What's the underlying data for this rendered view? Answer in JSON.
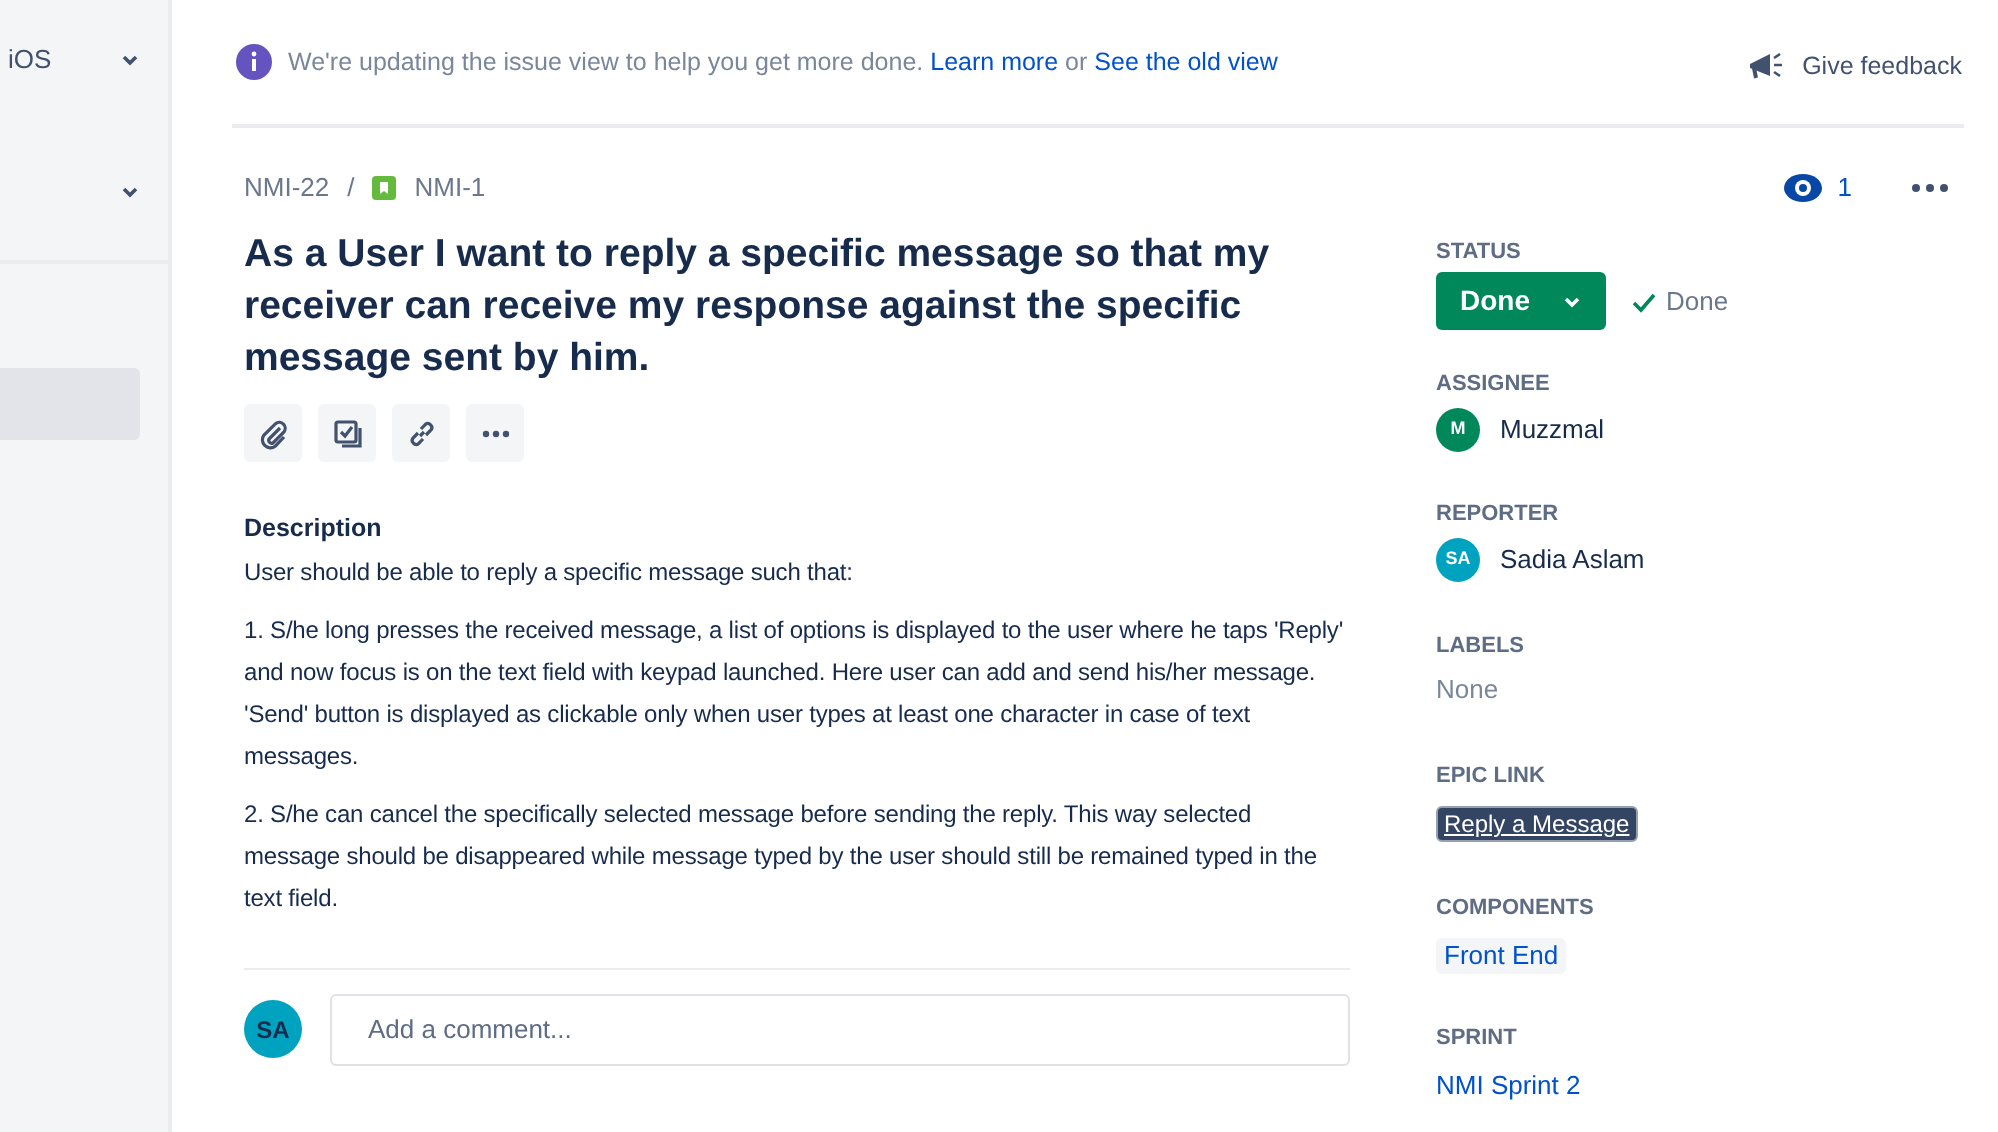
{
  "sidebar": {
    "items": [
      {
        "label": "iOS",
        "selected": false
      },
      {
        "selected": false
      },
      {
        "selected": true
      }
    ]
  },
  "banner": {
    "text": "We're updating the issue view to help you get more done.",
    "link1": "Learn more",
    "separator": "or",
    "link2": "See the old view",
    "feedback": "Give feedback"
  },
  "breadcrumb": {
    "parent": "NMI-22",
    "separator": "/",
    "issue": "NMI-1"
  },
  "watchers": "1",
  "title": "As a User I want to reply a specific message so that my receiver can receive my response against the specific message sent by him.",
  "description": {
    "heading": "Description",
    "paragraphs": [
      "User should be able to reply a specific message such that:",
      "1. S/he long presses the received message, a list of options is displayed to the user where he taps 'Reply' and now focus is on the text field with keypad launched. Here user can add and send his/her message. 'Send' button is displayed as clickable only when user types at least one character in case of text messages.",
      "2. S/he can cancel the specifically selected message before sending the reply. This way selected message should be disappeared while message typed by the user should still be remained typed in the text field."
    ]
  },
  "comment": {
    "avatar": "SA",
    "placeholder": "Add a comment..."
  },
  "fields": [
    {
      "kind": "status",
      "label": "STATUS",
      "value": "Done",
      "resolution": "Done"
    },
    {
      "kind": "user",
      "label": "ASSIGNEE",
      "initials": "M",
      "value": "Muzzmal",
      "color": "#00875a"
    },
    {
      "kind": "user",
      "label": "REPORTER",
      "initials": "SA",
      "value": "Sadia Aslam",
      "color": "#00a3bf"
    },
    {
      "kind": "empty",
      "label": "LABELS",
      "value": "None"
    },
    {
      "kind": "epic",
      "label": "EPIC LINK",
      "value": "Reply a Message"
    },
    {
      "kind": "tag",
      "label": "COMPONENTS",
      "value": "Front End"
    },
    {
      "kind": "link",
      "label": "SPRINT",
      "value": "NMI Sprint 2"
    }
  ]
}
